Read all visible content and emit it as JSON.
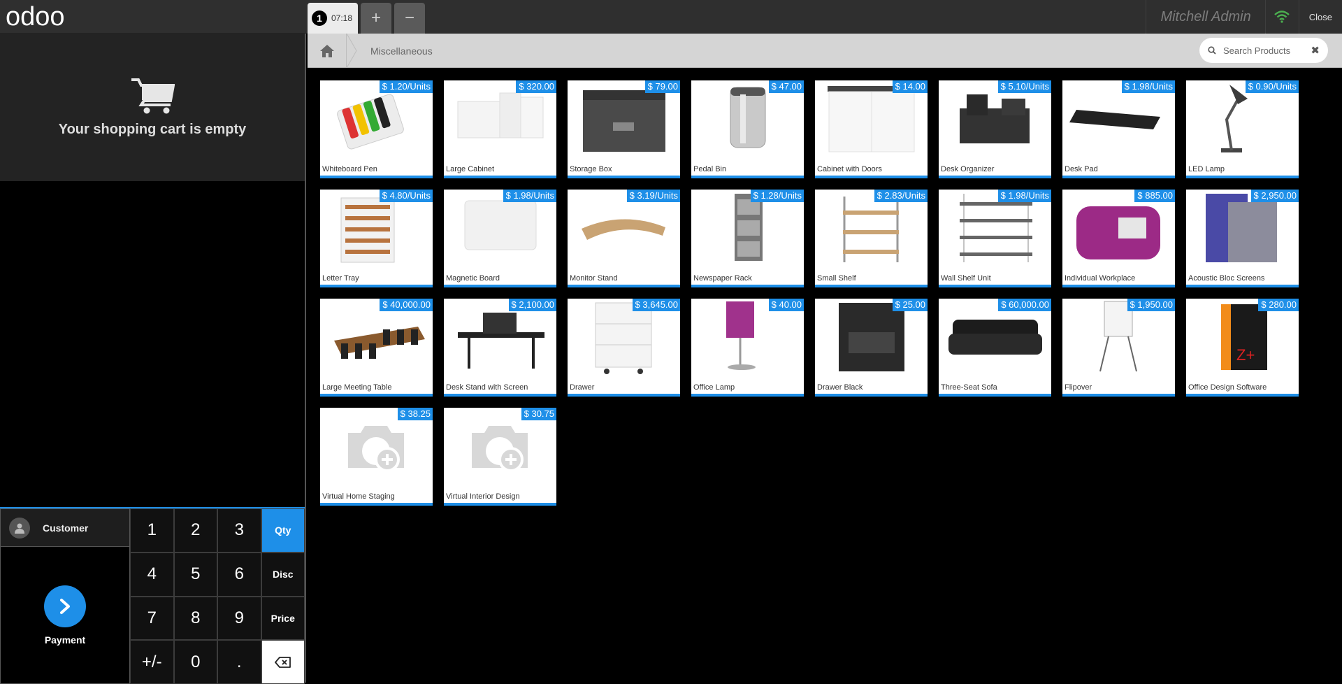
{
  "header": {
    "logo_text": "odoo",
    "order_number": "1",
    "order_time": "07:18",
    "add_label": "+",
    "remove_label": "−",
    "user": "Mitchell Admin",
    "close_label": "Close"
  },
  "cart": {
    "empty_text": "Your shopping cart is empty"
  },
  "breadcrumb": {
    "category": "Miscellaneous"
  },
  "search": {
    "placeholder": "Search Products"
  },
  "controls": {
    "customer_label": "Customer",
    "payment_label": "Payment",
    "keys": [
      "1",
      "2",
      "3",
      "Qty",
      "4",
      "5",
      "6",
      "Disc",
      "7",
      "8",
      "9",
      "Price",
      "+/-",
      "0",
      ".",
      ""
    ]
  },
  "products": [
    {
      "name": "Whiteboard Pen",
      "price": "$ 1.20/Units",
      "icon": "pens"
    },
    {
      "name": "Large Cabinet",
      "price": "$ 320.00",
      "icon": "cabinet"
    },
    {
      "name": "Storage Box",
      "price": "$ 79.00",
      "icon": "box"
    },
    {
      "name": "Pedal Bin",
      "price": "$ 47.00",
      "icon": "bin"
    },
    {
      "name": "Cabinet with Doors",
      "price": "$ 14.00",
      "icon": "cabinet-doors"
    },
    {
      "name": "Desk Organizer",
      "price": "$ 5.10/Units",
      "icon": "organizer"
    },
    {
      "name": "Desk Pad",
      "price": "$ 1.98/Units",
      "icon": "pad"
    },
    {
      "name": "LED Lamp",
      "price": "$ 0.90/Units",
      "icon": "lamp"
    },
    {
      "name": "Letter Tray",
      "price": "$ 4.80/Units",
      "icon": "tray"
    },
    {
      "name": "Magnetic Board",
      "price": "$ 1.98/Units",
      "icon": "board"
    },
    {
      "name": "Monitor Stand",
      "price": "$ 3.19/Units",
      "icon": "stand"
    },
    {
      "name": "Newspaper Rack",
      "price": "$ 1.28/Units",
      "icon": "rack"
    },
    {
      "name": "Small Shelf",
      "price": "$ 2.83/Units",
      "icon": "shelf"
    },
    {
      "name": "Wall Shelf Unit",
      "price": "$ 1.98/Units",
      "icon": "wall-shelf"
    },
    {
      "name": "Individual Workplace",
      "price": "$ 885.00",
      "icon": "workplace"
    },
    {
      "name": "Acoustic Bloc Screens",
      "price": "$ 2,950.00",
      "icon": "screens"
    },
    {
      "name": "Large Meeting Table",
      "price": "$ 40,000.00",
      "icon": "meeting-table"
    },
    {
      "name": "Desk Stand with Screen",
      "price": "$ 2,100.00",
      "icon": "desk"
    },
    {
      "name": "Drawer",
      "price": "$ 3,645.00",
      "icon": "drawer"
    },
    {
      "name": "Office Lamp",
      "price": "$ 40.00",
      "icon": "office-lamp"
    },
    {
      "name": "Drawer Black",
      "price": "$ 25.00",
      "icon": "drawer-black"
    },
    {
      "name": "Three-Seat Sofa",
      "price": "$ 60,000.00",
      "icon": "sofa"
    },
    {
      "name": "Flipover",
      "price": "$ 1,950.00",
      "icon": "flipover"
    },
    {
      "name": "Office Design Software",
      "price": "$ 280.00",
      "icon": "software"
    },
    {
      "name": "Virtual Home Staging",
      "price": "$ 38.25",
      "icon": "camera"
    },
    {
      "name": "Virtual Interior Design",
      "price": "$ 30.75",
      "icon": "camera"
    }
  ],
  "colors": {
    "accent": "#1e8fe8",
    "header": "#2f2f2f",
    "wifi": "#4caf50"
  }
}
